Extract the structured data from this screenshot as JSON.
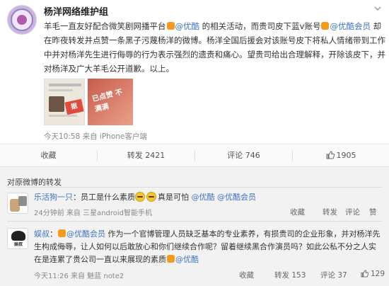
{
  "post": {
    "author": "杨洋网络维护组",
    "text": {
      "p1": "羊毛一直友好配合微笑剧网播平台",
      "mention_youku": "@优酷",
      "p2": " 的相关活动，而贵司皮下蓝v账号",
      "mention_youku_vip": "@优酷会员",
      "p3": " 却在昨夜转发并点赞一条黑子污蔑杨洋的微博。杨洋全国后援会对该账号皮下将私人情绪带到工作中并对杨洋先生进行侮辱的行为表示强烈的遗责和痛心。望贵司给出合理解释，开除该皮下，并对杨洋及广大羊毛公开道歉。以上。"
    },
    "photo_caption": "已点赞 不满满",
    "photo_caption2": "据",
    "meta": "今天10:58 来自 iPhone客户端"
  },
  "actions": {
    "favorite": "收藏",
    "repost": "转发 2421",
    "comment": "评论 746",
    "like": "1905"
  },
  "forwards": {
    "title": "对原微博的转发",
    "items": [
      {
        "user": "乐活狗一只",
        "text_before": "：员工是什么素质",
        "text_after": "真是可怕",
        "mention1": "@优酷",
        "mention2": "@优酷会员",
        "meta": "24分钟前 来自 三星android智能手机",
        "favorite": "收藏",
        "repost": "转发",
        "comment": "评论",
        "like": "赞"
      },
      {
        "user": "娱叔",
        "avatar_text": "娱叔",
        "colon": "：",
        "mention1": "@优酷会员",
        "text1": " 作为一个官博管理人员缺乏基本的专业素养，有损贵司的企业形象，并对杨洋先生构成侮辱，让人如何以后敢放心和你们继续合作呢？留着继续黑合作演员吗？如此公私不分之人实在是连累了贵公司一直以来展现的素质",
        "mention2": "@优酷",
        "meta": "今天11:26 来自 魅蓝 note2",
        "favorite": "收藏",
        "repost": "转发 153",
        "comment": "评论 37",
        "like": "129"
      }
    ]
  },
  "colors": {
    "link": "#3d74c5",
    "vip_badge": "#f49a1c",
    "background_panel": "#f2f2f2"
  }
}
